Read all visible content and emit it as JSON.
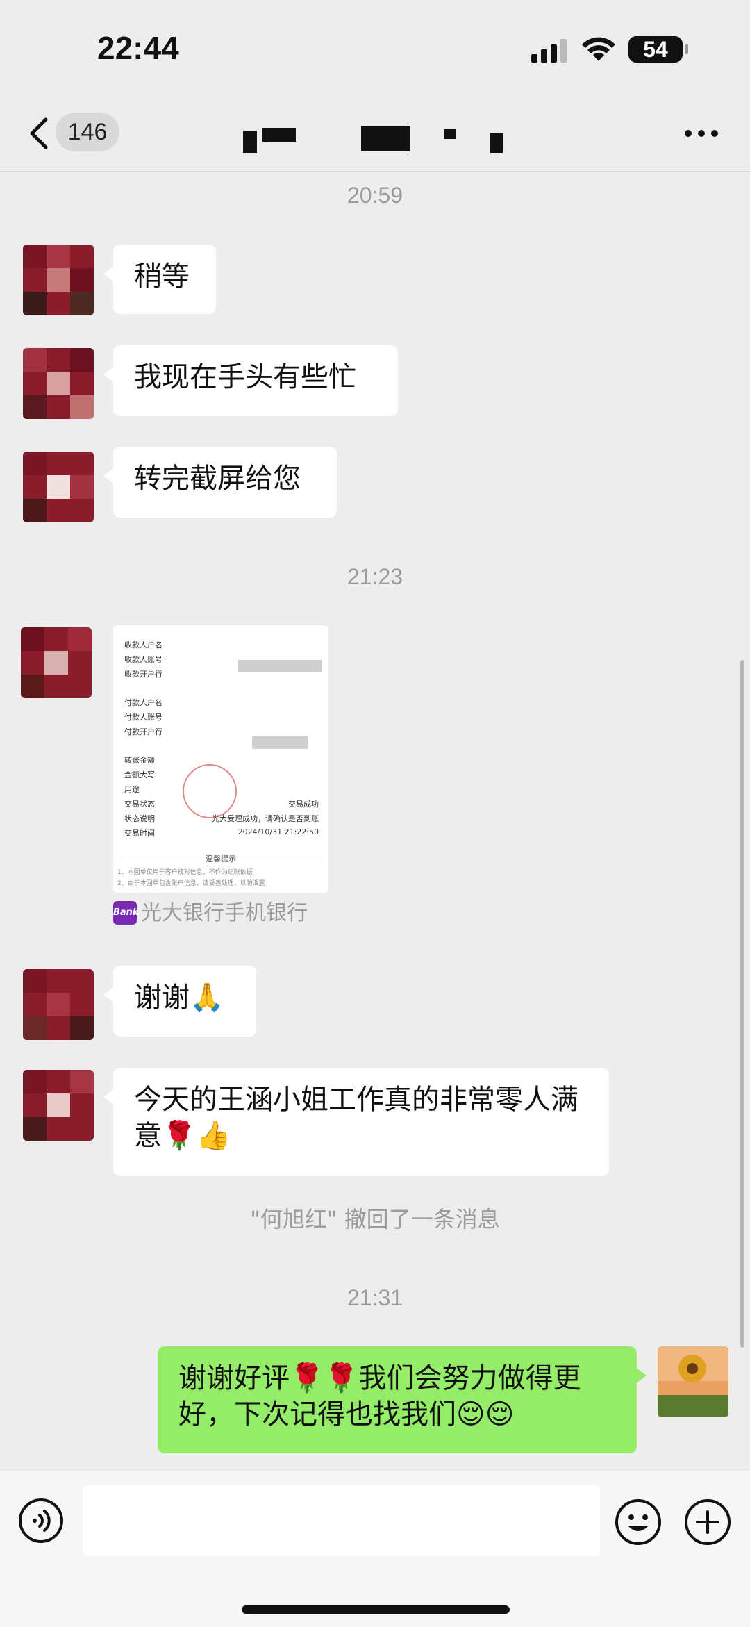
{
  "status_bar": {
    "time": "22:44",
    "battery": "54"
  },
  "nav": {
    "unread_count": "146"
  },
  "timestamps": [
    "20:59",
    "21:23",
    "21:31"
  ],
  "messages": [
    {
      "text": "稍等"
    },
    {
      "text": "我现在手头有些忙"
    },
    {
      "text": "转完截屏给您"
    },
    {
      "text": "谢谢🙏"
    },
    {
      "text": "今天的王涵小姐工作真的非常零人满意🌹👍"
    },
    {
      "text": "谢谢好评🌹🌹我们会努力做得更好，下次记得也找我们😌😌"
    }
  ],
  "receipt": {
    "labels": [
      "收款人户名",
      "收款人账号",
      "收款开户行",
      "付款人户名",
      "付款人账号",
      "付款开户行",
      "转账金额",
      "金额大写",
      "用途",
      "交易状态",
      "状态说明",
      "交易时间"
    ],
    "status_value": "交易成功",
    "status_desc": "光大受理成功，请确认是否到账",
    "trade_time": "2024/10/31 21:22:50",
    "tip_title": "温馨提示",
    "notes": [
      "1、本回单仅用于客户核对信息，不作为记账依据",
      "2、由于本回单包含账户信息，请妥善处理，以防泄露"
    ]
  },
  "source": {
    "logo": "Bank",
    "label": "光大银行手机银行"
  },
  "recall_notice": "\"何旭红\" 撤回了一条消息"
}
